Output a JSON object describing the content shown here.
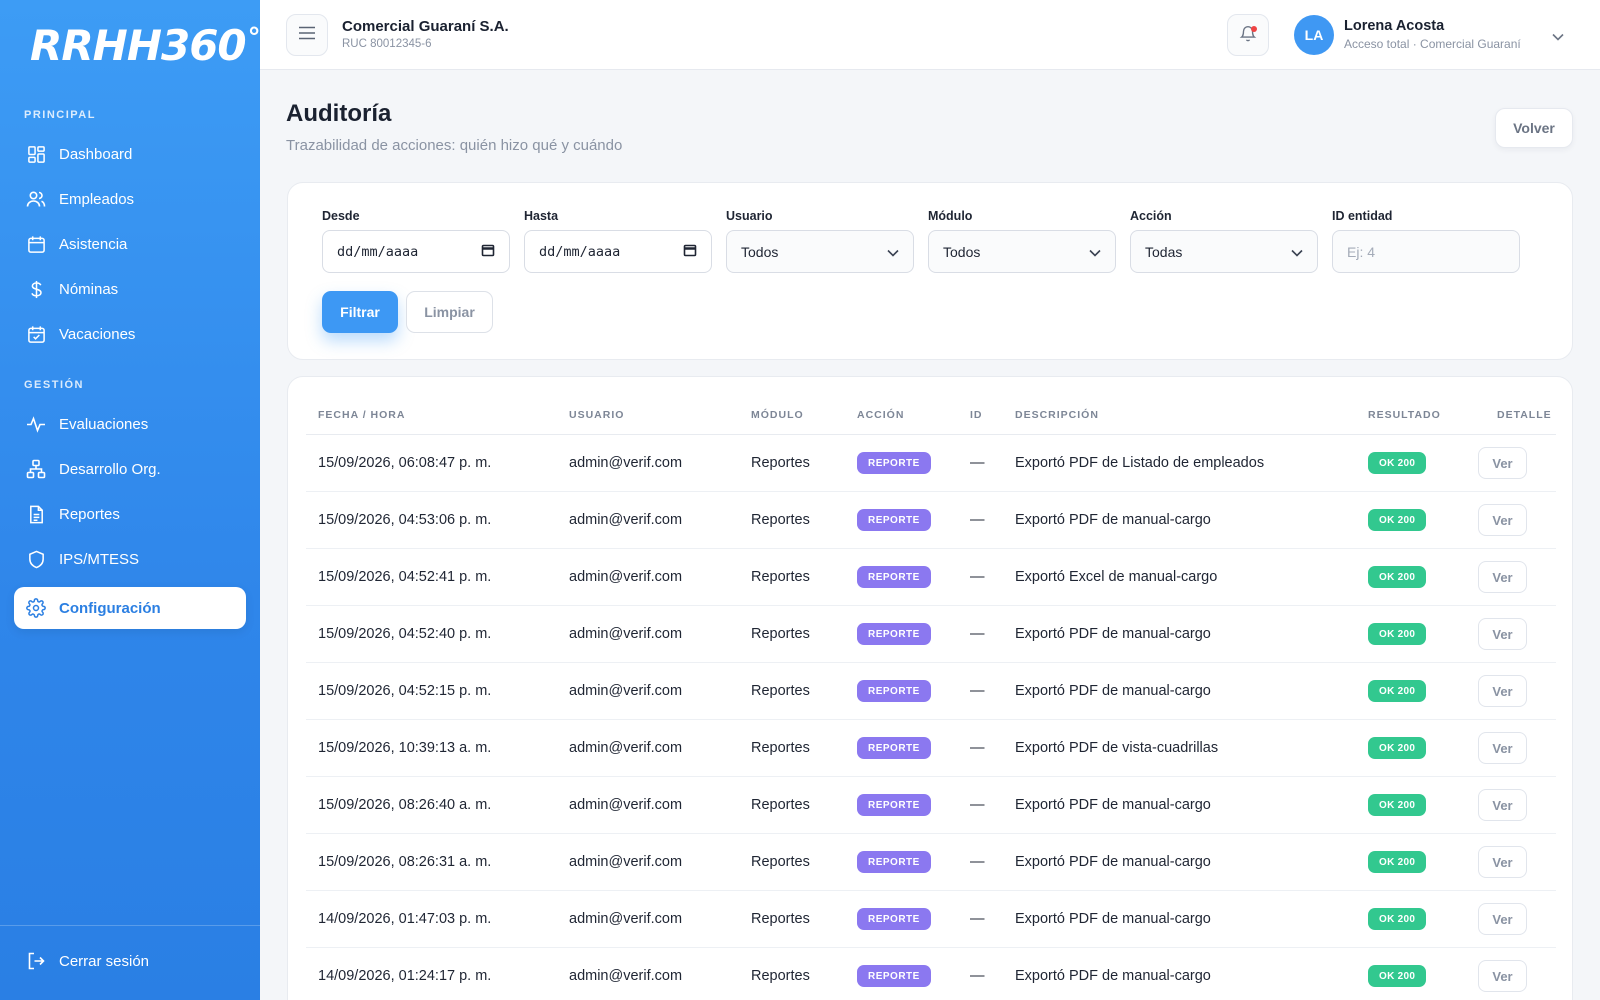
{
  "brand": {
    "logo": "RRHH360",
    "logo_suffix": "°"
  },
  "sidebar": {
    "section_principal": "PRINCIPAL",
    "section_gestion": "GESTIÓN",
    "items": [
      {
        "label": "Dashboard",
        "icon": "grid-icon"
      },
      {
        "label": "Empleados",
        "icon": "users-icon"
      },
      {
        "label": "Asistencia",
        "icon": "calendar-icon"
      },
      {
        "label": "Nóminas",
        "icon": "dollar-icon"
      },
      {
        "label": "Vacaciones",
        "icon": "calendar-check-icon"
      },
      {
        "label": "Evaluaciones",
        "icon": "activity-icon"
      },
      {
        "label": "Desarrollo Org.",
        "icon": "org-chart-icon"
      },
      {
        "label": "Reportes",
        "icon": "document-icon"
      },
      {
        "label": "IPS/MTESS",
        "icon": "shield-icon"
      },
      {
        "label": "Configuración",
        "icon": "gear-icon"
      }
    ],
    "active_item": "Configuración",
    "logout_label": "Cerrar sesión"
  },
  "topbar": {
    "company_name": "Comercial Guaraní S.A.",
    "company_ruc": "RUC 80012345-6",
    "user_initials": "LA",
    "user_name": "Lorena Acosta",
    "user_role": "Acceso total · Comercial Guaraní"
  },
  "page": {
    "title": "Auditoría",
    "subtitle": "Trazabilidad de acciones: quién hizo qué y cuándo",
    "back_label": "Volver"
  },
  "filters": {
    "desde_label": "Desde",
    "desde_value": "dd/mm/aaaa",
    "hasta_label": "Hasta",
    "hasta_value": "dd/mm/aaaa",
    "usuario_label": "Usuario",
    "usuario_value": "Todos",
    "modulo_label": "Módulo",
    "modulo_value": "Todos",
    "accion_label": "Acción",
    "accion_value": "Todas",
    "id_label": "ID entidad",
    "id_placeholder": "Ej: 4",
    "filter_label": "Filtrar",
    "clear_label": "Limpiar"
  },
  "table": {
    "columns": [
      "FECHA / HORA",
      "USUARIO",
      "MÓDULO",
      "ACCIÓN",
      "ID",
      "DESCRIPCIÓN",
      "RESULTADO",
      "DETALLE"
    ],
    "detail_label": "Ver",
    "rows": [
      {
        "fecha": "15/09/2026, 06:08:47 p. m.",
        "usuario": "admin@verif.com",
        "modulo": "Reportes",
        "accion": "REPORTE",
        "id": "—",
        "descripcion": "Exportó PDF de Listado de empleados",
        "resultado": "OK 200"
      },
      {
        "fecha": "15/09/2026, 04:53:06 p. m.",
        "usuario": "admin@verif.com",
        "modulo": "Reportes",
        "accion": "REPORTE",
        "id": "—",
        "descripcion": "Exportó PDF de manual-cargo",
        "resultado": "OK 200"
      },
      {
        "fecha": "15/09/2026, 04:52:41 p. m.",
        "usuario": "admin@verif.com",
        "modulo": "Reportes",
        "accion": "REPORTE",
        "id": "—",
        "descripcion": "Exportó Excel de manual-cargo",
        "resultado": "OK 200"
      },
      {
        "fecha": "15/09/2026, 04:52:40 p. m.",
        "usuario": "admin@verif.com",
        "modulo": "Reportes",
        "accion": "REPORTE",
        "id": "—",
        "descripcion": "Exportó PDF de manual-cargo",
        "resultado": "OK 200"
      },
      {
        "fecha": "15/09/2026, 04:52:15 p. m.",
        "usuario": "admin@verif.com",
        "modulo": "Reportes",
        "accion": "REPORTE",
        "id": "—",
        "descripcion": "Exportó PDF de manual-cargo",
        "resultado": "OK 200"
      },
      {
        "fecha": "15/09/2026, 10:39:13 a. m.",
        "usuario": "admin@verif.com",
        "modulo": "Reportes",
        "accion": "REPORTE",
        "id": "—",
        "descripcion": "Exportó PDF de vista-cuadrillas",
        "resultado": "OK 200"
      },
      {
        "fecha": "15/09/2026, 08:26:40 a. m.",
        "usuario": "admin@verif.com",
        "modulo": "Reportes",
        "accion": "REPORTE",
        "id": "—",
        "descripcion": "Exportó PDF de manual-cargo",
        "resultado": "OK 200"
      },
      {
        "fecha": "15/09/2026, 08:26:31 a. m.",
        "usuario": "admin@verif.com",
        "modulo": "Reportes",
        "accion": "REPORTE",
        "id": "—",
        "descripcion": "Exportó PDF de manual-cargo",
        "resultado": "OK 200"
      },
      {
        "fecha": "14/09/2026, 01:47:03 p. m.",
        "usuario": "admin@verif.com",
        "modulo": "Reportes",
        "accion": "REPORTE",
        "id": "—",
        "descripcion": "Exportó PDF de manual-cargo",
        "resultado": "OK 200"
      },
      {
        "fecha": "14/09/2026, 01:24:17 p. m.",
        "usuario": "admin@verif.com",
        "modulo": "Reportes",
        "accion": "REPORTE",
        "id": "—",
        "descripcion": "Exportó PDF de manual-cargo",
        "resultado": "OK 200"
      }
    ]
  },
  "colors": {
    "primary": "#3d98f4",
    "action_badge": "#8b78f0",
    "ok_badge": "#32c88f"
  }
}
